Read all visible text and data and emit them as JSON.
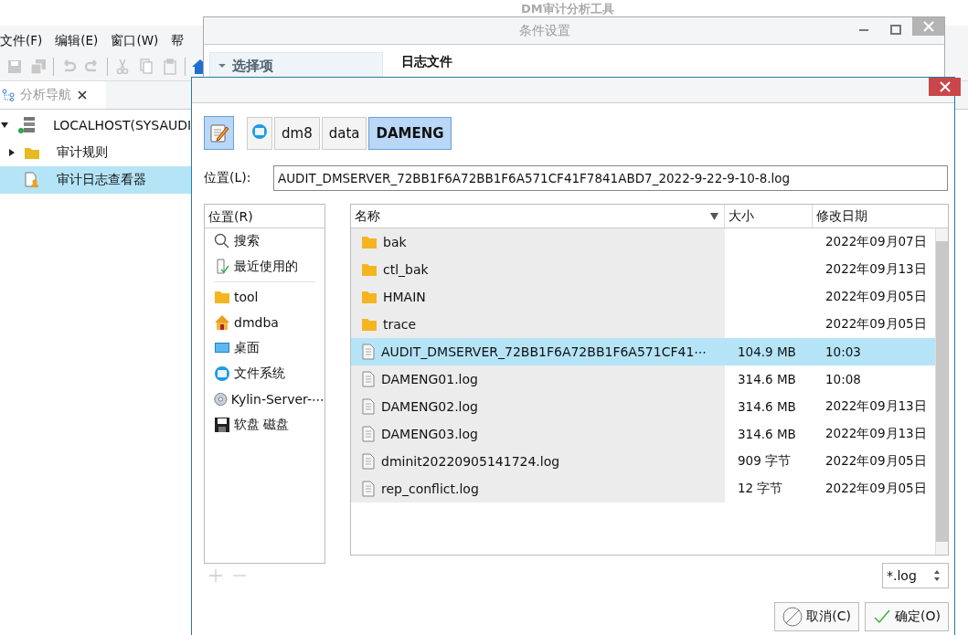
{
  "app": {
    "title": "DM审计分析工具",
    "menu": [
      "文件(F)",
      "编辑(E)",
      "窗口(W)",
      "帮"
    ],
    "toolbar": [
      {
        "kind": "save",
        "disabled": true
      },
      {
        "kind": "save-all",
        "disabled": true
      },
      {
        "kind": "undo",
        "disabled": true
      },
      {
        "kind": "redo",
        "disabled": true
      },
      {
        "kind": "cut",
        "disabled": true
      },
      {
        "kind": "copy",
        "disabled": true
      },
      {
        "kind": "paste",
        "disabled": true
      },
      {
        "kind": "home",
        "disabled": false
      }
    ],
    "nav_tab": {
      "label": "分析导航"
    },
    "tree": [
      {
        "label": "LOCALHOST(SYSAUDI",
        "kind": "server",
        "expanded": true,
        "selected": false,
        "children": [
          {
            "label": "审计规则",
            "kind": "folder",
            "expanded": false,
            "selected": false
          },
          {
            "label": "审计日志查看器",
            "kind": "viewer",
            "selected": true
          }
        ]
      }
    ]
  },
  "condition_dialog": {
    "title": "条件设置",
    "section": {
      "label": "选择项",
      "expanded": true
    },
    "field_label": "日志文件"
  },
  "file_dialog": {
    "edit_toggle": {
      "on": true
    },
    "path": [
      {
        "kind": "drive",
        "selected": false
      },
      {
        "kind": "folder",
        "label": "dm8",
        "selected": false
      },
      {
        "kind": "folder",
        "label": "data",
        "selected": false
      },
      {
        "kind": "folder",
        "label": "DAMENG",
        "selected": true
      }
    ],
    "location": {
      "label": "位置(L):",
      "value": "AUDIT_DMSERVER_72BB1F6A72BB1F6A571CF41F7841ABD7_2022-9-22-9-10-8.log"
    },
    "places": {
      "header": "位置(R)",
      "items": [
        {
          "label": "搜索",
          "kind": "search"
        },
        {
          "label": "最近使用的",
          "kind": "recent"
        },
        {
          "label": "tool",
          "kind": "folder"
        },
        {
          "label": "dmdba",
          "kind": "home"
        },
        {
          "label": "桌面",
          "kind": "desktop"
        },
        {
          "label": "文件系统",
          "kind": "drive"
        },
        {
          "label": "Kylin-Server-⋯",
          "kind": "disc"
        },
        {
          "label": "软盘 磁盘",
          "kind": "floppy"
        }
      ]
    },
    "columns": [
      {
        "label": "名称",
        "sorted": true
      },
      {
        "label": "大小",
        "sorted": false
      },
      {
        "label": "修改日期",
        "sorted": false
      }
    ],
    "files": [
      {
        "name": "bak",
        "kind": "folder",
        "modified": "2022年09月07日",
        "selected": false
      },
      {
        "name": "ctl_bak",
        "kind": "folder",
        "modified": "2022年09月13日",
        "selected": false
      },
      {
        "name": "HMAIN",
        "kind": "folder",
        "modified": "2022年09月05日",
        "selected": false
      },
      {
        "name": "trace",
        "kind": "folder",
        "modified": "2022年09月05日",
        "selected": false
      },
      {
        "name": "AUDIT_DMSERVER_72BB1F6A72BB1F6A571CF41⋯",
        "kind": "file",
        "size": "104.9 MB",
        "modified": "10:03",
        "selected": true
      },
      {
        "name": "DAMENG01.log",
        "kind": "file",
        "size": "314.6 MB",
        "modified": "10:08",
        "selected": false
      },
      {
        "name": "DAMENG02.log",
        "kind": "file",
        "size": "314.6 MB",
        "modified": "2022年09月13日",
        "selected": false
      },
      {
        "name": "DAMENG03.log",
        "kind": "file",
        "size": "314.6 MB",
        "modified": "2022年09月13日",
        "selected": false
      },
      {
        "name": "dminit20220905141724.log",
        "kind": "file",
        "size": "909 字节",
        "modified": "2022年09月05日",
        "selected": false
      },
      {
        "name": "rep_conflict.log",
        "kind": "file",
        "size": "12 字节",
        "modified": "2022年09月05日",
        "selected": false
      }
    ],
    "filter": "*.log",
    "buttons": [
      {
        "label": "取消(C)",
        "kind": "cancel"
      },
      {
        "label": "确定(O)",
        "kind": "ok"
      }
    ]
  }
}
